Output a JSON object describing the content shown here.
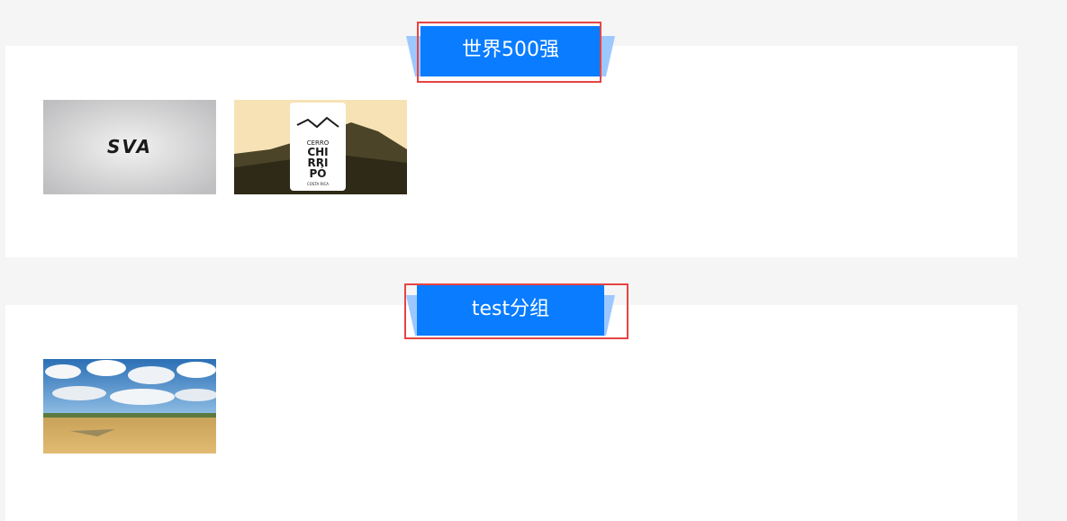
{
  "groups": [
    {
      "title": "世界500强",
      "items": [
        {
          "image": "sva-logo-thumbnail",
          "logo_text": "SVA"
        },
        {
          "image": "cerro-chirripo-thumbnail",
          "logo_lines": [
            "CERRO",
            "CHI",
            "RRI",
            "PÓ"
          ],
          "logo_footer": "COSTA RICA"
        }
      ]
    },
    {
      "title": "test分组",
      "items": [
        {
          "image": "wheat-field-sky-thumbnail"
        }
      ]
    }
  ],
  "colors": {
    "page_background": "#f5f5f5",
    "panel_background": "#ffffff",
    "ribbon_main": "#0a7cff",
    "ribbon_wing": "#9cc8ff",
    "highlight_border": "#e84343"
  }
}
